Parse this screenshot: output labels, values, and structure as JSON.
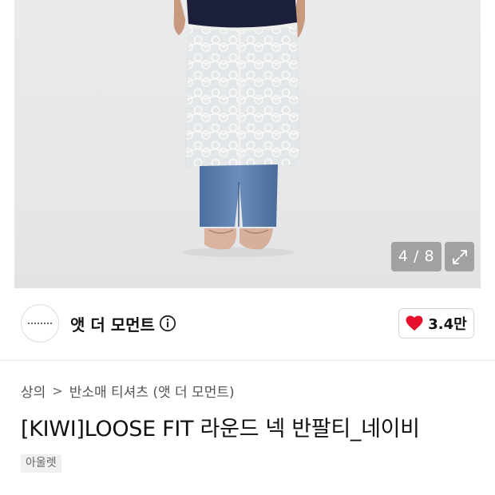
{
  "gallery": {
    "counter_text": "4 / 8",
    "expand_icon": "expand-arrows-icon"
  },
  "brand": {
    "name": "앳 더 모먼트",
    "info_icon": "info-circle-icon"
  },
  "like": {
    "icon": "heart-icon",
    "count": "3.4만",
    "heart_color": "#e8112d"
  },
  "breadcrumb": {
    "items": [
      "상의",
      "반소매 티셔츠 (앳 더 모먼트)"
    ],
    "separator": ">"
  },
  "product": {
    "title": "[KIWI]LOOSE FIT 라운드 넥 반팔티_네이비",
    "tag": "아울렛"
  }
}
